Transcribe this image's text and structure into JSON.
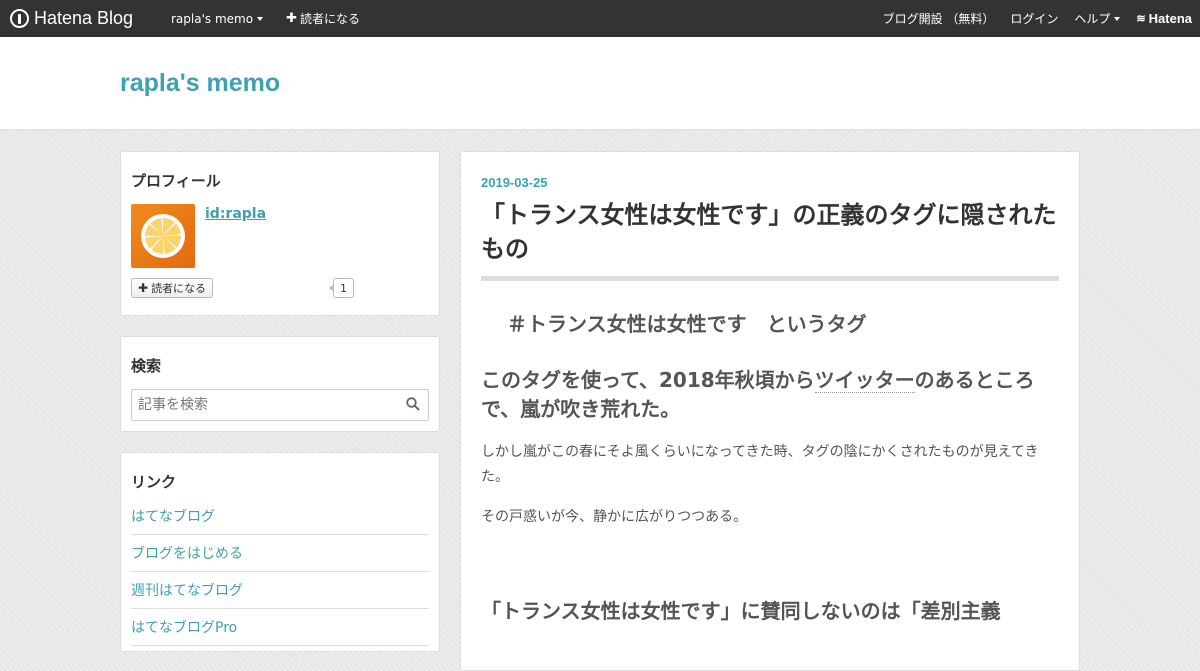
{
  "topbar": {
    "logo": "Hatena Blog",
    "blog_menu": "rapla's memo",
    "subscribe": "読者になる",
    "start_blog": "ブログ開設 （無料）",
    "login": "ログイン",
    "help": "ヘルプ",
    "hatena": "Hatena"
  },
  "header": {
    "title": "rapla's memo"
  },
  "profile": {
    "title": "プロフィール",
    "id": "id:rapla",
    "subscribe_label": "読者になる",
    "subscriber_count": "1"
  },
  "search": {
    "title": "検索",
    "placeholder": "記事を検索"
  },
  "links": {
    "title": "リンク",
    "items": [
      {
        "label": "はてなブログ"
      },
      {
        "label": "ブログをはじめる"
      },
      {
        "label": "週刊はてなブログ"
      },
      {
        "label": "はてなブログPro"
      }
    ]
  },
  "article": {
    "date": "2019-03-25",
    "title": "「トランス女性は女性です」の正義のタグに隠されたもの",
    "heading_tag": "＃トランス女性は女性です　というタグ",
    "heading_storm_pre": "このタグを使って、2018年秋頃から",
    "heading_storm_link": "ツイッター",
    "heading_storm_post": "のあるところで、嵐が吹き荒れた。",
    "p1": "しかし嵐がこの春にそよ風くらいになってきた時、タグの陰にかくされたものが見えてきた。",
    "p2": "その戸惑いが今、静かに広がりつつある。",
    "heading_next": "「トランス女性は女性です」に賛同しないのは「差別主義"
  },
  "colors": {
    "accent": "#3f9fb3",
    "topbar": "#333333"
  }
}
